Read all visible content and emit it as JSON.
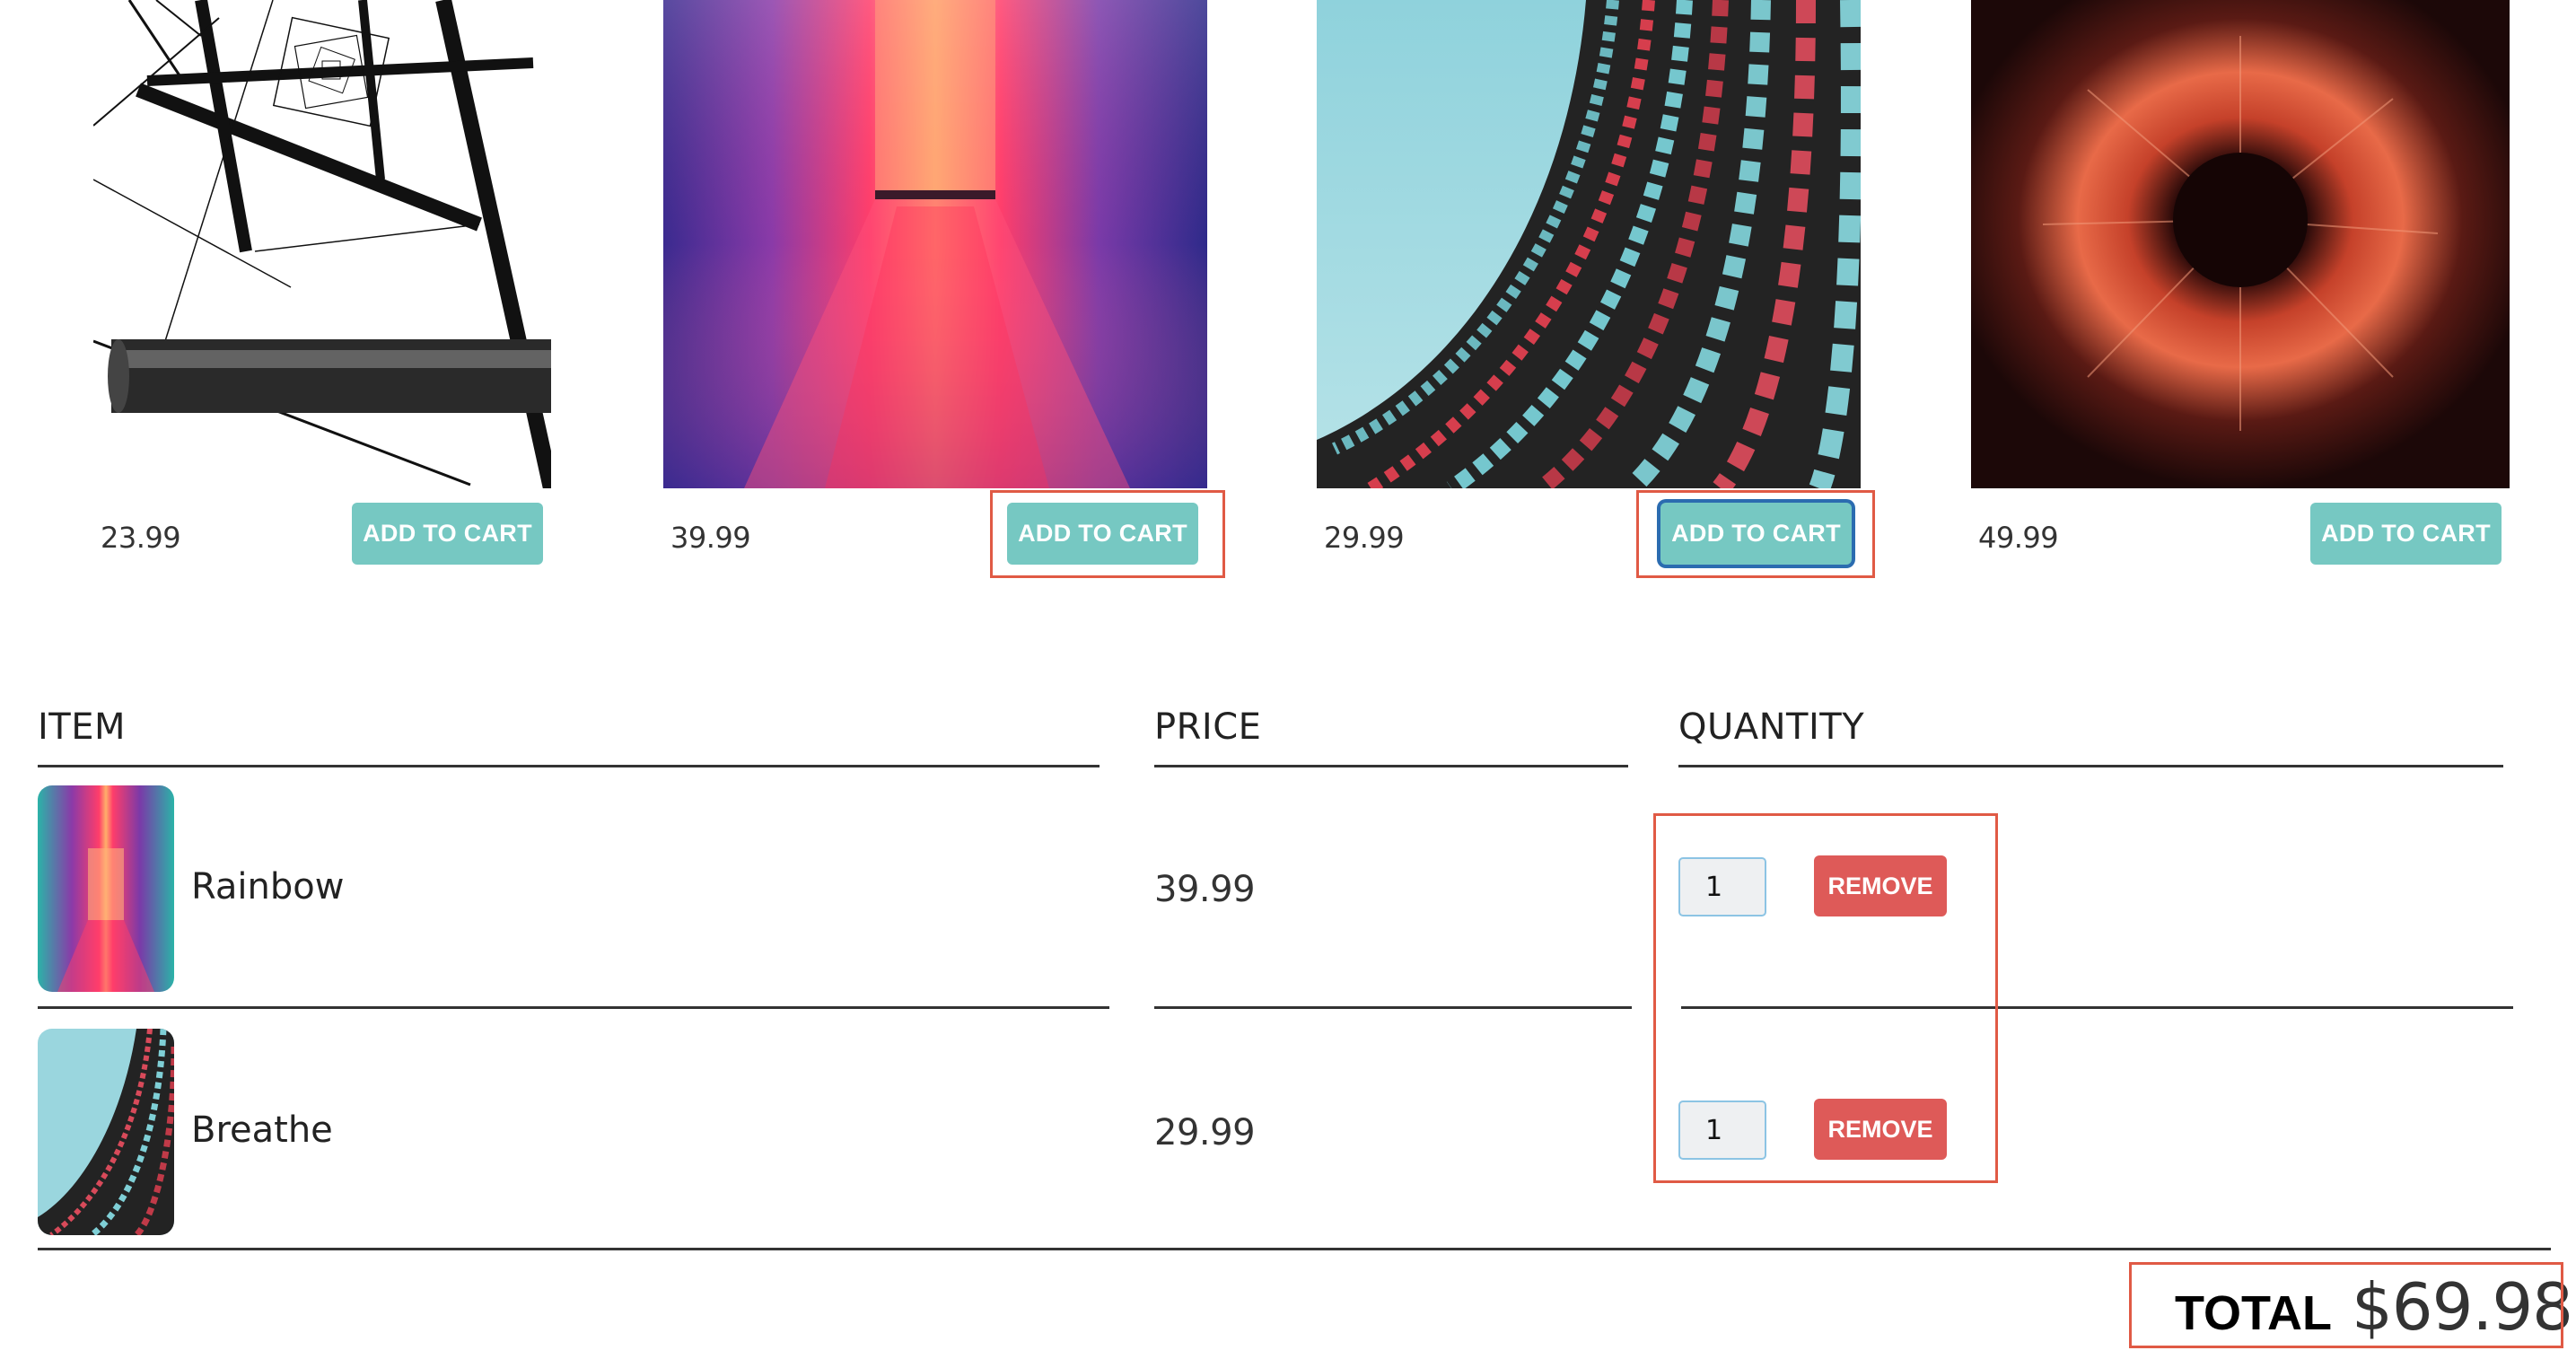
{
  "products": [
    {
      "price": "23.99",
      "button_label": "ADD TO CART",
      "image_icon": "tower-photo"
    },
    {
      "price": "39.99",
      "button_label": "ADD TO CART",
      "image_icon": "rainbow-corridor-photo"
    },
    {
      "price": "29.99",
      "button_label": "ADD TO CART",
      "image_icon": "building-facade-photo"
    },
    {
      "price": "49.99",
      "button_label": "ADD TO CART",
      "image_icon": "orange-burst-photo"
    }
  ],
  "cart": {
    "headers": {
      "item": "ITEM",
      "price": "PRICE",
      "quantity": "QUANTITY"
    },
    "rows": [
      {
        "title": "Rainbow",
        "price": "39.99",
        "quantity": "1",
        "remove_label": "REMOVE"
      },
      {
        "title": "Breathe",
        "price": "29.99",
        "quantity": "1",
        "remove_label": "REMOVE"
      }
    ],
    "total_label": "TOTAL",
    "total_value": "$69.98"
  },
  "colors": {
    "accent_teal": "#76c8c2",
    "remove_red": "#de5a58",
    "highlight": "#e05a45",
    "focus_blue": "#2b6cb0"
  }
}
